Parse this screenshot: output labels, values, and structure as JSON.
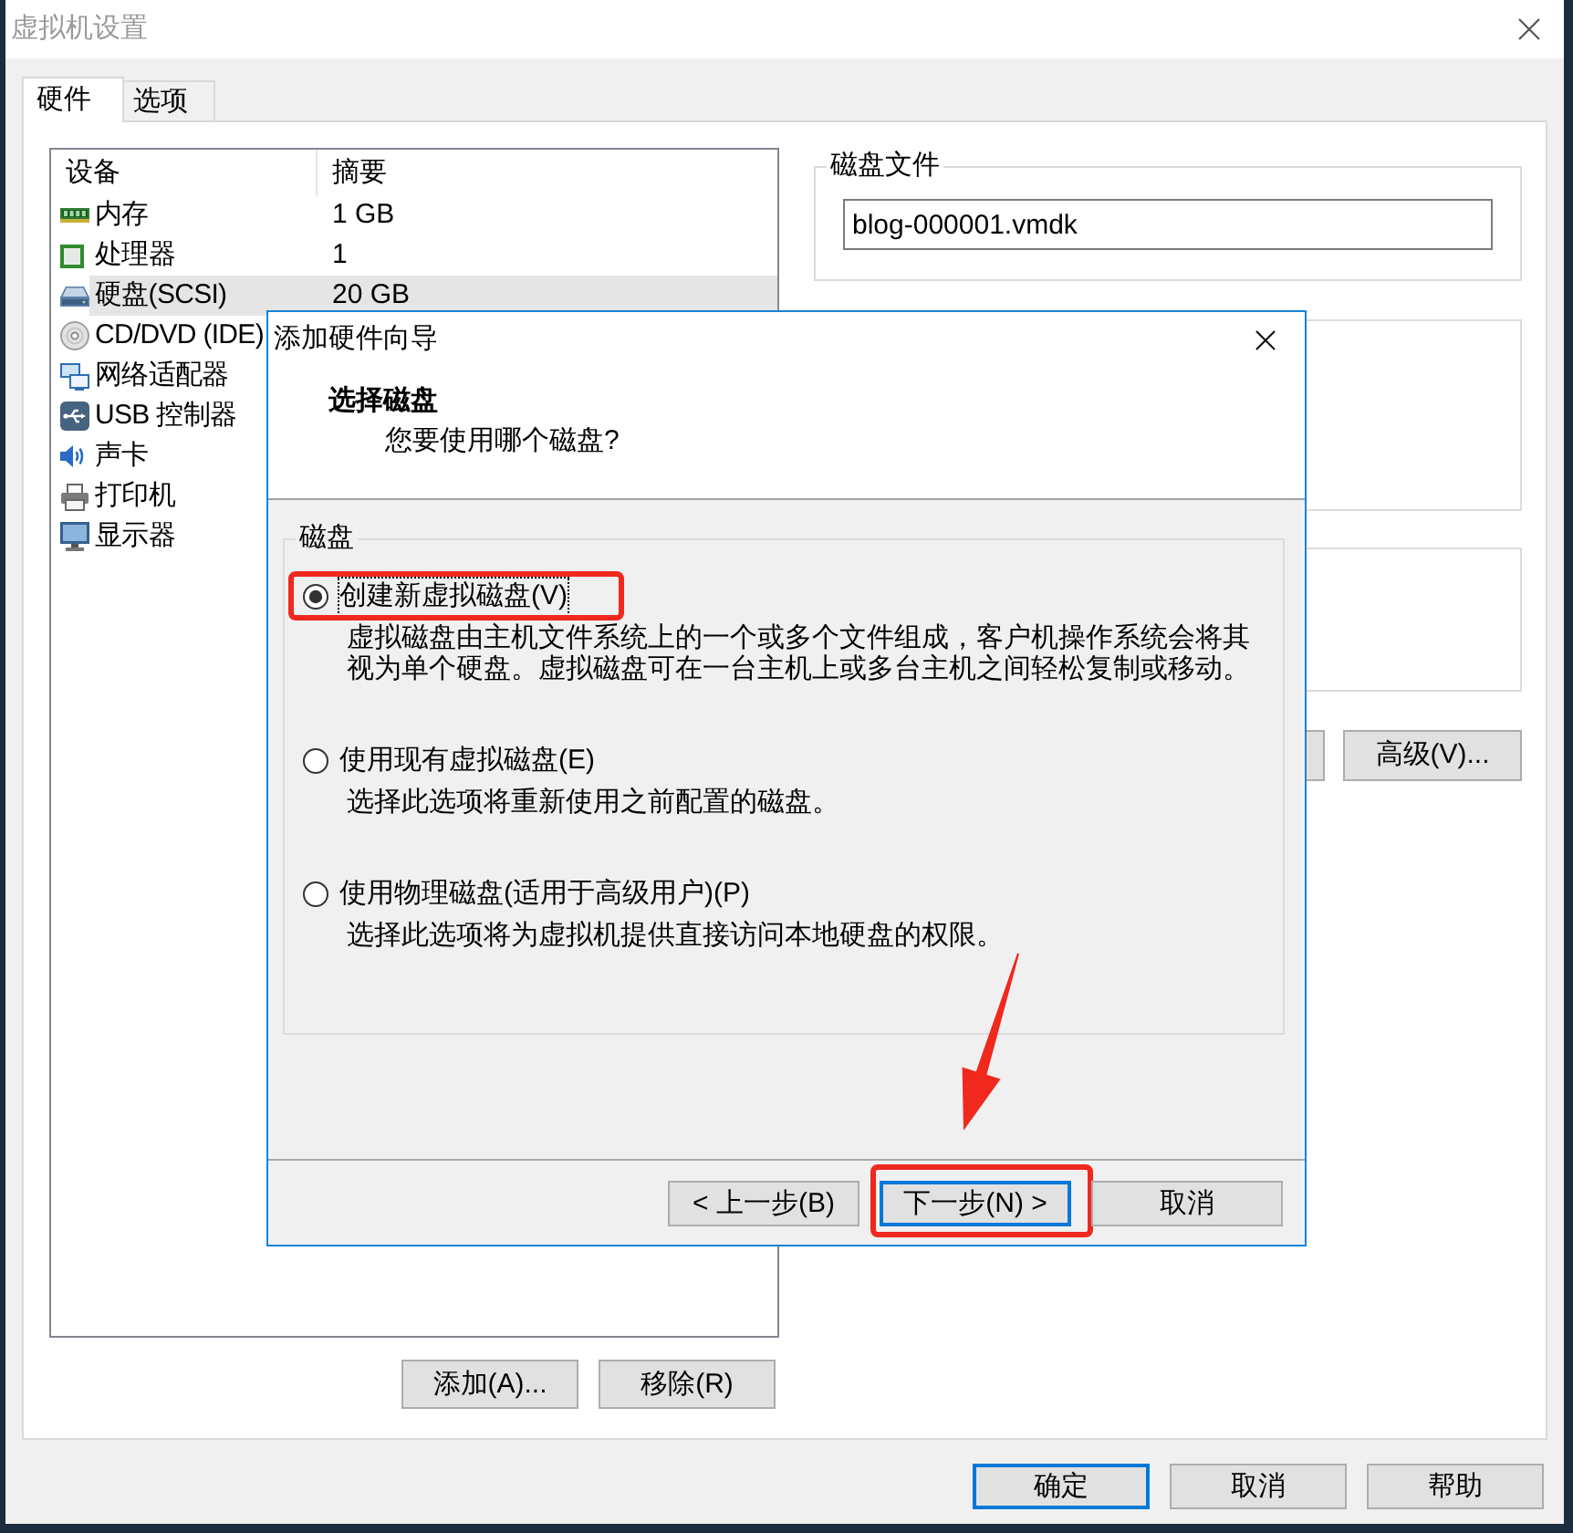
{
  "window": {
    "title": "虚拟机设置"
  },
  "tabs": [
    {
      "label": "硬件",
      "selected": true
    },
    {
      "label": "选项",
      "selected": false
    }
  ],
  "device_list": {
    "columns": [
      "设备",
      "摘要"
    ],
    "rows": [
      {
        "kind": "memory",
        "device": "内存",
        "summary": "1 GB",
        "selected": false
      },
      {
        "kind": "processor",
        "device": "处理器",
        "summary": "1",
        "selected": false
      },
      {
        "kind": "disk",
        "device": "硬盘(SCSI)",
        "summary": "20 GB",
        "selected": true
      },
      {
        "kind": "cdrom",
        "device": "CD/DVD (IDE)",
        "selected": false
      },
      {
        "kind": "network",
        "device": "网络适配器",
        "selected": false
      },
      {
        "kind": "usb",
        "device": "USB 控制器",
        "selected": false
      },
      {
        "kind": "sound",
        "device": "声卡",
        "selected": false
      },
      {
        "kind": "printer",
        "device": "打印机",
        "selected": false
      },
      {
        "kind": "display",
        "device": "显示器",
        "selected": false
      }
    ]
  },
  "list_buttons": [
    "添加(A)...",
    "移除(R)"
  ],
  "disk_file": {
    "label": "磁盘文件",
    "value": "blog-000001.vmdk"
  },
  "advanced_button": "高级(V)...",
  "footer_buttons": [
    {
      "label": "确定",
      "default": true
    },
    {
      "label": "取消",
      "default": false
    },
    {
      "label": "帮助",
      "default": false
    }
  ],
  "dialog": {
    "title": "添加硬件向导",
    "heading": "选择磁盘",
    "subheading": "您要使用哪个磁盘?",
    "group_label": "磁盘",
    "options": [
      {
        "label": "创建新虚拟磁盘(V)",
        "description": "虚拟磁盘由主机文件系统上的一个或多个文件组成，客户机操作系统会将其视为单个硬盘。虚拟磁盘可在一台主机上或多台主机之间轻松复制或移动。",
        "selected": true,
        "highlighted": true
      },
      {
        "label": "使用现有虚拟磁盘(E)",
        "description": "选择此选项将重新使用之前配置的磁盘。",
        "selected": false,
        "highlighted": false
      },
      {
        "label": "使用物理磁盘(适用于高级用户)(P)",
        "description": "选择此选项将为虚拟机提供直接访问本地硬盘的权限。",
        "selected": false,
        "highlighted": false
      }
    ],
    "buttons": [
      {
        "label": "< 上一步(B)",
        "default": false,
        "highlighted": false
      },
      {
        "label": "下一步(N) >",
        "default": true,
        "highlighted": true
      },
      {
        "label": "取消",
        "default": false,
        "highlighted": false
      }
    ]
  }
}
